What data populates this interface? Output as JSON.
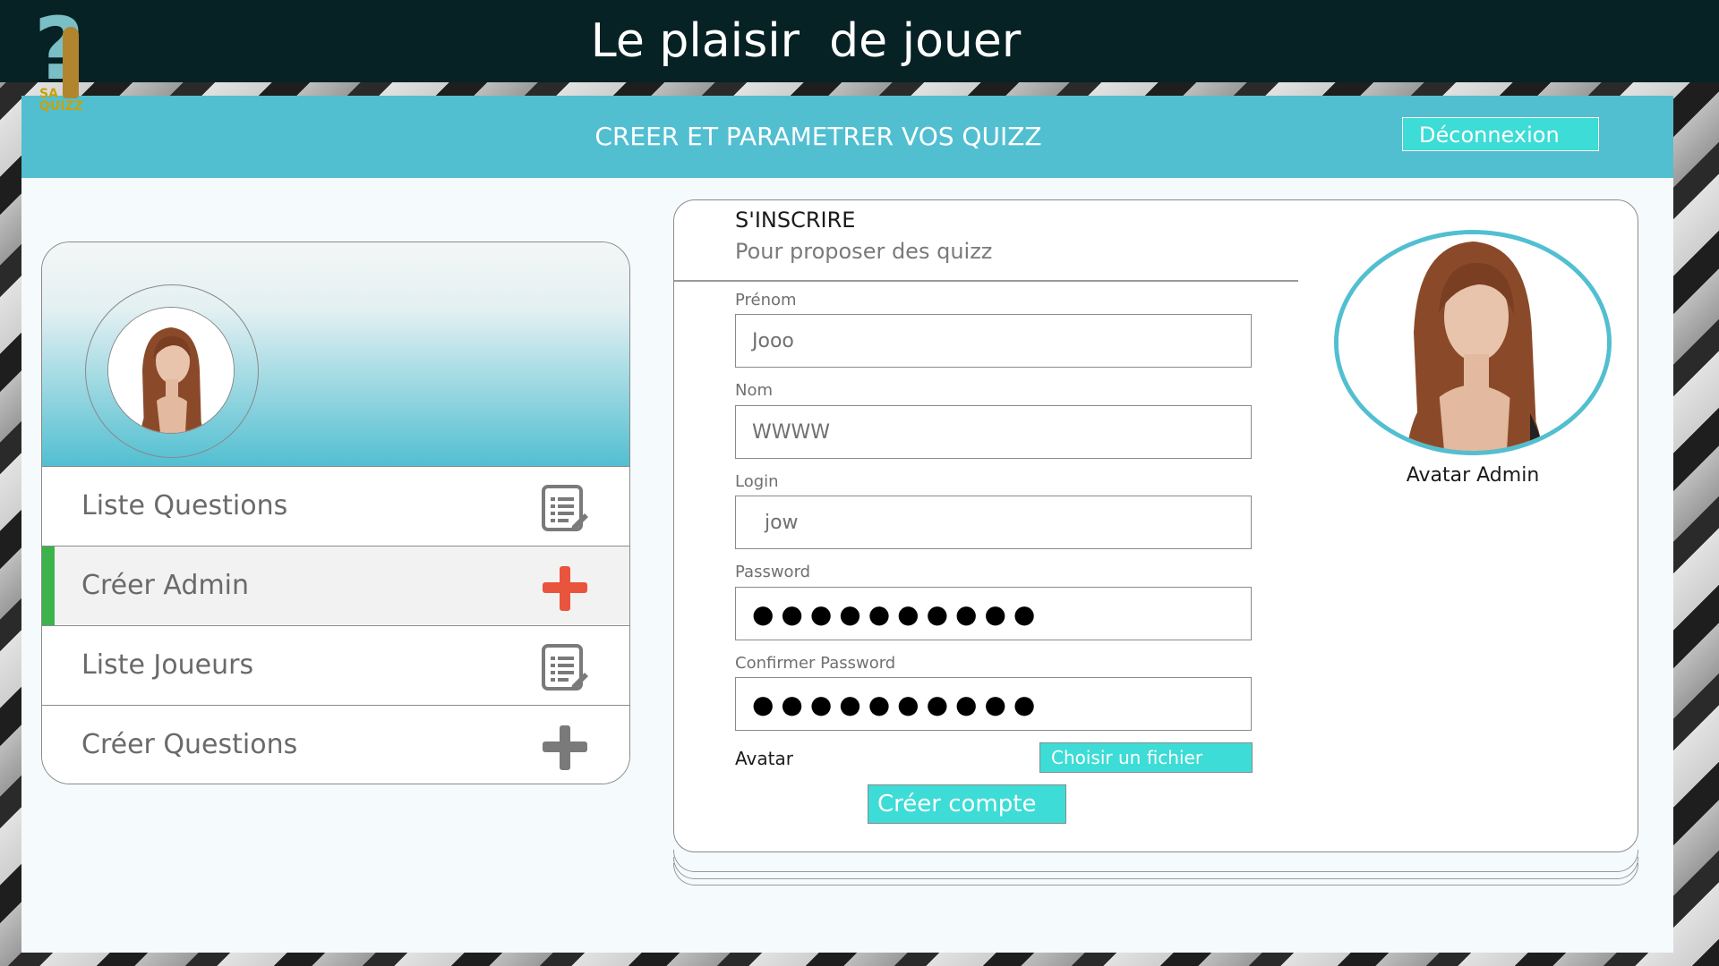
{
  "app": {
    "title": "Le plaisir  de jouer",
    "logo_text": "SA QUIZZ"
  },
  "header": {
    "title": "CREER ET PARAMETRER VOS QUIZZ",
    "logout_label": "Déconnexion"
  },
  "sidebar": {
    "items": [
      {
        "label": "Liste Questions",
        "icon": "list-edit-icon",
        "active": false
      },
      {
        "label": "Créer Admin",
        "icon": "plus-icon",
        "active": true
      },
      {
        "label": "Liste Joueurs",
        "icon": "list-edit-icon",
        "active": false
      },
      {
        "label": "Créer Questions",
        "icon": "plus-icon",
        "active": false
      }
    ]
  },
  "form": {
    "title": "S'INSCRIRE",
    "subtitle": "Pour proposer des quizz",
    "fields": {
      "prenom": {
        "label": "Prénom",
        "value": "Jooo"
      },
      "nom": {
        "label": "Nom",
        "value": "WWWW"
      },
      "login": {
        "label": "Login",
        "value": "  jow"
      },
      "password": {
        "label": "Password",
        "value": "●●●●●●●●●●"
      },
      "confirm_password": {
        "label": "Confirmer Password",
        "value": "●●●●●●●●●●"
      }
    },
    "avatar_label": "Avatar",
    "file_button": "Choisir un fichier",
    "submit_button": "Créer compte",
    "avatar_caption": "Avatar Admin"
  },
  "colors": {
    "topbar": "#062224",
    "accent": "#52bfd1",
    "button": "#3ddcd6",
    "active_marker": "#3cb34a",
    "plus_active": "#e8553c",
    "plus_default": "#7a7a7a"
  }
}
